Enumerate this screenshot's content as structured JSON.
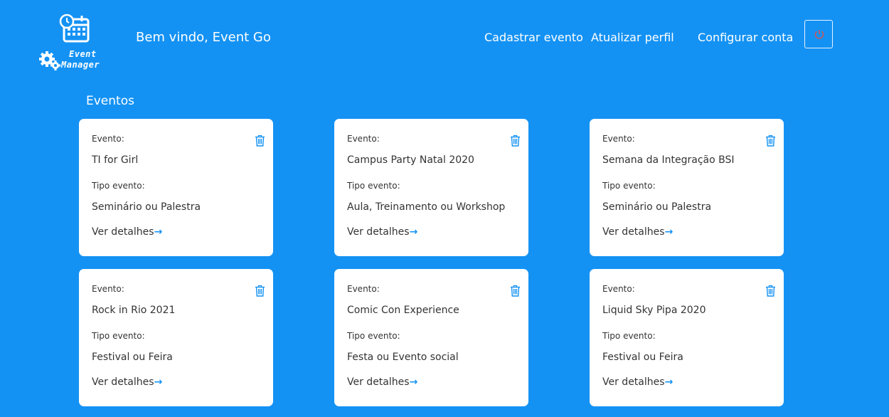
{
  "header": {
    "logo_line1": "Event",
    "logo_line2": "Manager",
    "welcome": "Bem vindo, Event Go",
    "nav": {
      "create_event": "Cadastrar evento",
      "update_profile": "Atualizar perfil",
      "configure_account": "Configurar conta"
    }
  },
  "section_title": "Eventos",
  "labels": {
    "event": "Evento:",
    "type": "Tipo evento:",
    "details": "Ver detalhes",
    "arrow": "→"
  },
  "events": [
    {
      "name": "TI for Girl",
      "type": "Seminário ou Palestra"
    },
    {
      "name": "Campus Party Natal 2020",
      "type": "Aula, Treinamento ou Workshop"
    },
    {
      "name": "Semana da Integração BSI",
      "type": "Seminário ou Palestra"
    },
    {
      "name": "Rock in Rio 2021",
      "type": "Festival ou Feira"
    },
    {
      "name": "Comic Con Experience",
      "type": "Festa ou Evento social"
    },
    {
      "name": "Liquid Sky Pipa 2020",
      "type": "Festival ou Feira"
    }
  ],
  "colors": {
    "background": "#1492f4",
    "card": "#ffffff",
    "accent": "#1492f4",
    "power_icon": "#d9534f"
  },
  "icons": {
    "logo": "calendar-gears-icon",
    "delete": "trash-icon",
    "logout": "power-icon",
    "details": "arrow-right-icon"
  }
}
